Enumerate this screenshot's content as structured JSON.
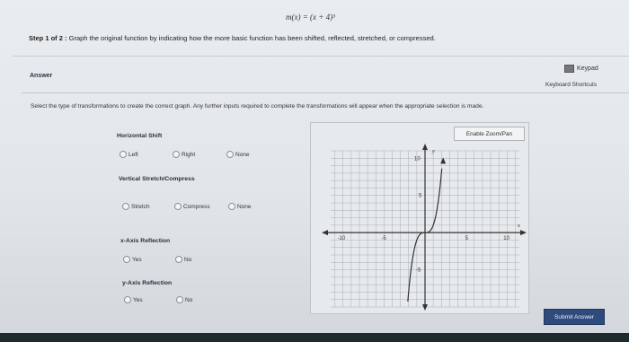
{
  "formula": "m(x) = (x + 4)³",
  "step": {
    "label": "Step 1 of 2 :",
    "text": "Graph the original function by indicating how the more basic function has been shifted, reflected, stretched, or compressed."
  },
  "answer_label": "Answer",
  "keypad_label": "Keypad",
  "keyboard_shortcuts_label": "Keyboard Shortcuts",
  "instructions": "Select the type of transformations to create the correct graph. Any further inputs required to complete the transformations will appear when the appropriate selection is made.",
  "sections": {
    "horizontal_shift": {
      "title": "Horizontal Shift",
      "options": [
        "Left",
        "Right",
        "None"
      ]
    },
    "vertical_stretch": {
      "title": "Vertical Stretch/Compress",
      "options": [
        "Stretch",
        "Compress",
        "None"
      ]
    },
    "x_reflection": {
      "title": "x-Axis Reflection",
      "options": [
        "Yes",
        "No"
      ]
    },
    "y_reflection": {
      "title": "y-Axis Reflection",
      "options": [
        "Yes",
        "No"
      ]
    }
  },
  "zoom_label": "Enable Zoom/Pan",
  "graph": {
    "x_label": "x",
    "y_label": "y",
    "ticks": {
      "x_neg10": "-10",
      "x_neg5": "-5",
      "x_5": "5",
      "x_10": "10",
      "y_10": "10",
      "y_5": "5",
      "y_neg5": "-5"
    },
    "curve_function": "y = x^3"
  },
  "submit_label": "Submit Answer",
  "colors": {
    "submit_bg": "#2f4a7c",
    "panel_bg": "#e7eaed",
    "grid": "#a9aeb4",
    "axis": "#333333"
  }
}
